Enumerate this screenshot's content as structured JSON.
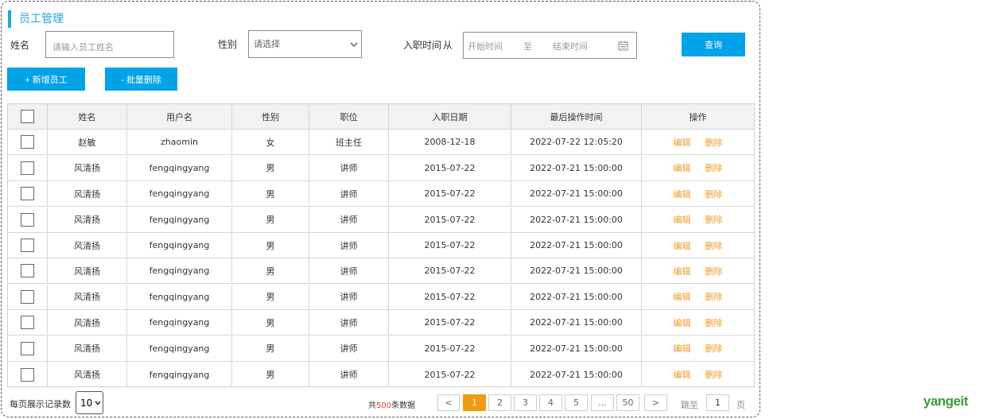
{
  "page": {
    "title": "员工管理"
  },
  "search": {
    "name_label": "姓名",
    "name_placeholder": "请输入员工姓名",
    "gender_label": "性别",
    "gender_placeholder": "请选择",
    "date_label": "入职时间",
    "date_from": "从",
    "date_start_placeholder": "开始时间",
    "date_to": "至",
    "date_end_placeholder": "结束时间",
    "query_button": "查询"
  },
  "actions": {
    "add_button": "+ 新增员工",
    "batch_delete_button": "- 批量删除"
  },
  "table": {
    "headers": [
      "姓名",
      "用户名",
      "性别",
      "职位",
      "入职日期",
      "最后操作时间",
      "操作"
    ],
    "edit_label": "编辑",
    "delete_label": "删除",
    "rows": [
      [
        "赵敏",
        "zhaomin",
        "女",
        "班主任",
        "2008-12-18",
        "2022-07-22 12:05:20"
      ],
      [
        "风清扬",
        "fengqingyang",
        "男",
        "讲师",
        "2015-07-22",
        "2022-07-21 15:00:00"
      ],
      [
        "风清扬",
        "fengqingyang",
        "男",
        "讲师",
        "2015-07-22",
        "2022-07-21 15:00:00"
      ],
      [
        "风清扬",
        "fengqingyang",
        "男",
        "讲师",
        "2015-07-22",
        "2022-07-21 15:00:00"
      ],
      [
        "风清扬",
        "fengqingyang",
        "男",
        "讲师",
        "2015-07-22",
        "2022-07-21 15:00:00"
      ],
      [
        "风清扬",
        "fengqingyang",
        "男",
        "讲师",
        "2015-07-22",
        "2022-07-21 15:00:00"
      ],
      [
        "风清扬",
        "fengqingyang",
        "男",
        "讲师",
        "2015-07-22",
        "2022-07-21 15:00:00"
      ],
      [
        "风清扬",
        "fengqingyang",
        "男",
        "讲师",
        "2015-07-22",
        "2022-07-21 15:00:00"
      ],
      [
        "风清扬",
        "fengqingyang",
        "男",
        "讲师",
        "2015-07-22",
        "2022-07-21 15:00:00"
      ],
      [
        "风清扬",
        "fengqingyang",
        "男",
        "讲师",
        "2015-07-22",
        "2022-07-21 15:00:00"
      ]
    ]
  },
  "pagination": {
    "per_page_label": "每页展示记录数",
    "per_page_value": "10",
    "total_prefix": "共",
    "total_count": "500",
    "total_suffix": "条数据",
    "prev": "<",
    "pages": [
      "1",
      "2",
      "3",
      "4",
      "5",
      "...",
      "50"
    ],
    "next": ">",
    "goto_label": "跳至",
    "goto_value": "1",
    "page_unit": "页"
  },
  "brand": {
    "name": "yangeit",
    "color": "#3a9a3a"
  },
  "colors": {
    "accent": "#00a2e8",
    "action": "#f39a2c",
    "active_page": "#f39a14"
  },
  "icons": {
    "select_arrow": "chevron-down-icon",
    "calendar": "calendar-icon"
  }
}
